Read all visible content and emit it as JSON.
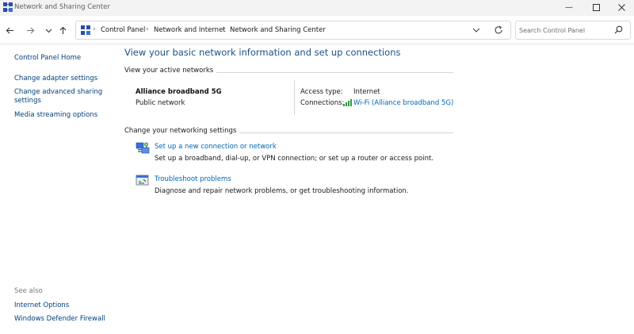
{
  "window": {
    "title": "Network and Sharing Center",
    "icons": {
      "app": "network-center-icon",
      "minimize": "minimize-icon",
      "maximize": "maximize-icon",
      "close": "close-icon"
    }
  },
  "nav": {
    "icons": {
      "back": "arrow-left-icon",
      "forward": "arrow-right-icon",
      "recent": "chevron-down-icon",
      "up": "arrow-up-icon"
    }
  },
  "address": {
    "breadcrumb": [
      "Control Panel",
      "Network and Internet",
      "Network and Sharing Center"
    ],
    "icons": {
      "location": "control-panel-icon",
      "dropdown": "chevron-down-icon",
      "refresh": "refresh-icon"
    }
  },
  "search": {
    "placeholder": "Search Control Panel",
    "icon": "search-icon"
  },
  "sidebar": {
    "links": [
      "Control Panel Home",
      "Change adapter settings",
      "Change advanced sharing settings",
      "Media streaming options"
    ],
    "see_also_label": "See also",
    "see_also": [
      "Internet Options",
      "Windows Defender Firewall"
    ]
  },
  "main": {
    "heading": "View your basic network information and set up connections",
    "active_networks_label": "View your active networks",
    "network": {
      "name": "Alliance broadband 5G",
      "category": "Public network",
      "access_type_label": "Access type:",
      "access_type_value": "Internet",
      "connections_label": "Connections:",
      "connection_link": "Wi-Fi (Alliance broadband 5G)",
      "connection_icon": "wifi-signal-icon"
    },
    "settings_label": "Change your networking settings",
    "tasks": [
      {
        "link": "Set up a new connection or network",
        "description": "Set up a broadband, dial-up, or VPN connection; or set up a router or access point.",
        "icon": "new-connection-icon"
      },
      {
        "link": "Troubleshoot problems",
        "description": "Diagnose and repair network problems, or get troubleshooting information.",
        "icon": "troubleshoot-icon"
      }
    ]
  },
  "colors": {
    "link": "#0066b4",
    "heading": "#1b4f8a",
    "sidebar_link": "#003f7d",
    "divider": "#d6d6d6",
    "titlebar": "#f3f3f3"
  }
}
